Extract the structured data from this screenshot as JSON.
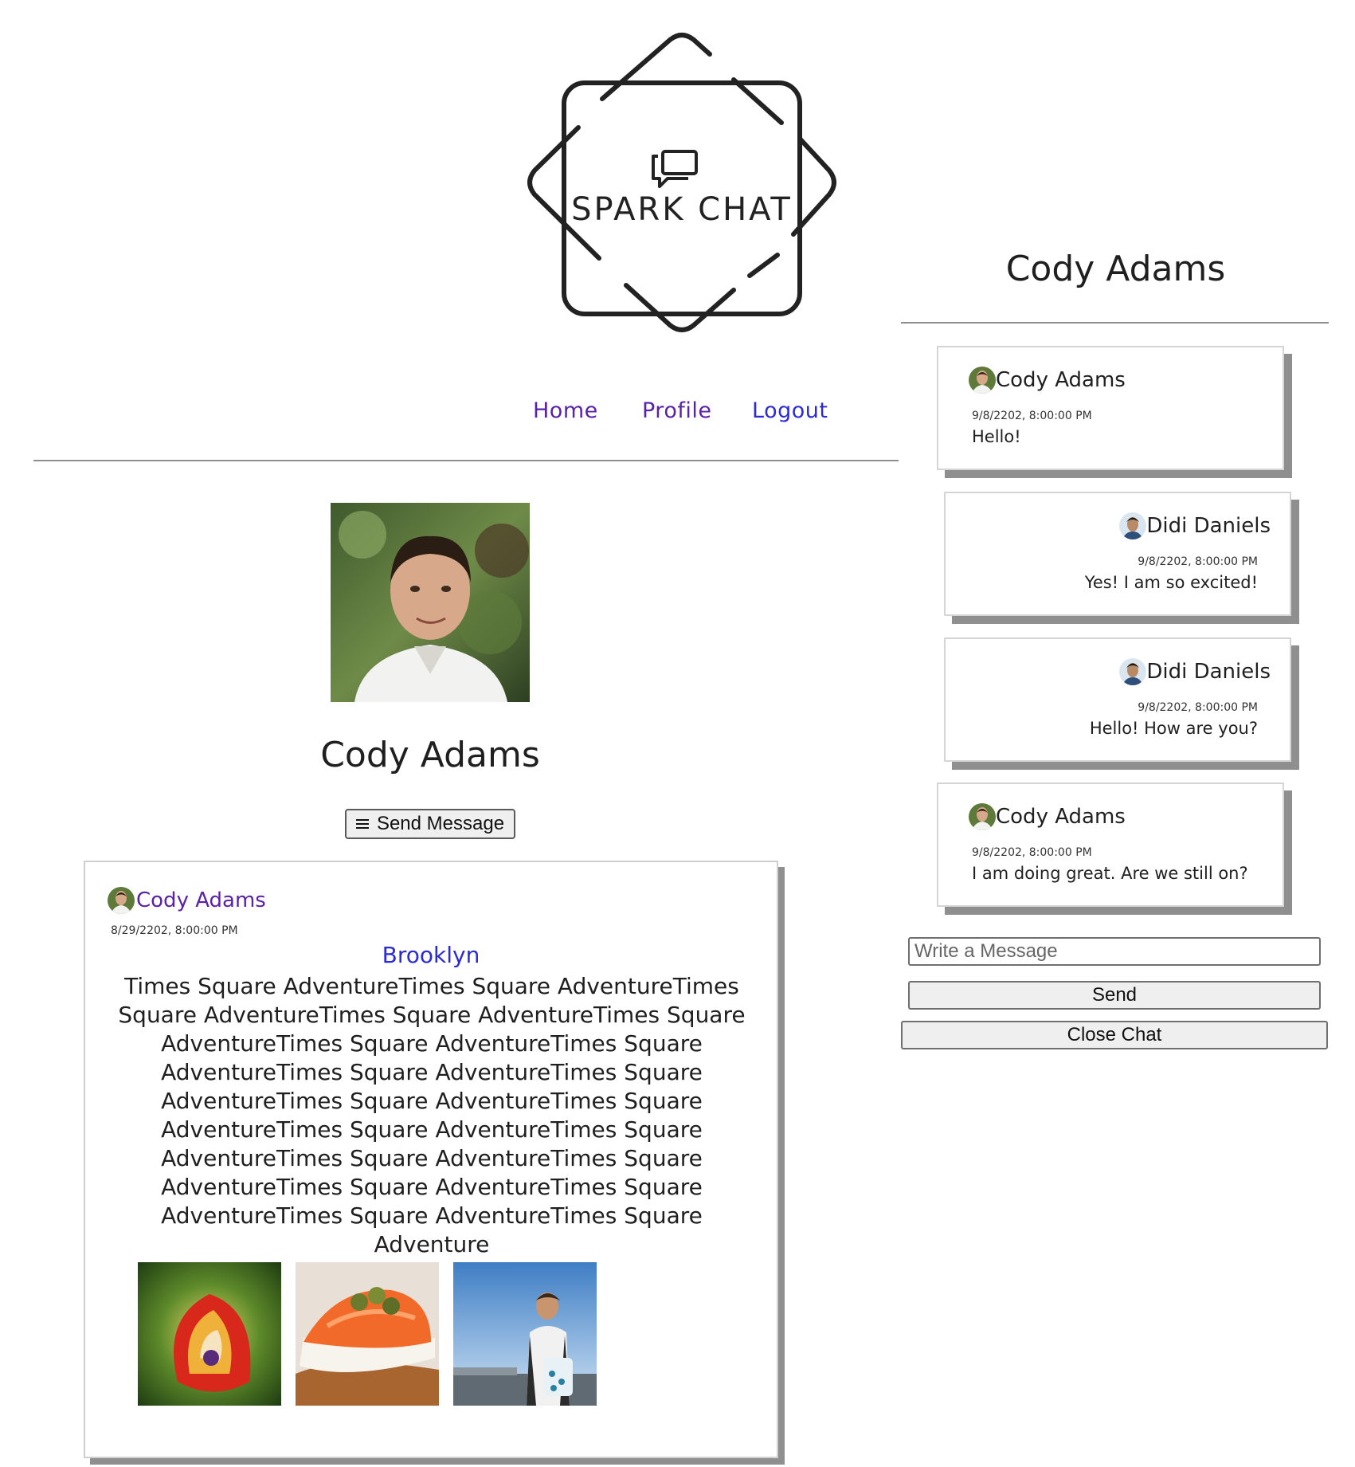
{
  "logo": {
    "text": "SPARK CHAT"
  },
  "nav": {
    "home": "Home",
    "profile": "Profile",
    "logout": "Logout"
  },
  "profile": {
    "name": "Cody Adams",
    "send_message_label": "Send Message"
  },
  "post": {
    "author": "Cody Adams",
    "date": "8/29/2202, 8:00:00 PM",
    "location": "Brooklyn",
    "lines": [
      "Times Square AdventureTimes Square AdventureTimes",
      "Square AdventureTimes Square AdventureTimes Square",
      "AdventureTimes Square AdventureTimes Square",
      "AdventureTimes Square AdventureTimes Square",
      "AdventureTimes Square AdventureTimes Square",
      "AdventureTimes Square AdventureTimes Square",
      "AdventureTimes Square AdventureTimes Square",
      "AdventureTimes Square AdventureTimes Square",
      "AdventureTimes Square AdventureTimes Square Adventure"
    ],
    "images": [
      "flower-photo",
      "salmon-toast-photo",
      "person-at-harbor-photo"
    ]
  },
  "chat": {
    "title": "Cody Adams",
    "messages": [
      {
        "author": "Cody Adams",
        "date": "9/8/2202, 8:00:00 PM",
        "text": "Hello!",
        "side": "left"
      },
      {
        "author": "Didi Daniels",
        "date": "9/8/2202, 8:00:00 PM",
        "text": "Yes! I am so excited!",
        "side": "right"
      },
      {
        "author": "Didi Daniels",
        "date": "9/8/2202, 8:00:00 PM",
        "text": "Hello! How are you?",
        "side": "right"
      },
      {
        "author": "Cody Adams",
        "date": "9/8/2202, 8:00:00 PM",
        "text": "I am doing great. Are we still on?",
        "side": "left"
      }
    ],
    "input_placeholder": "Write a Message",
    "send_label": "Send",
    "close_label": "Close Chat"
  },
  "colors": {
    "nav_link": "#5a22a8",
    "nav_link_visited": "#2b2bd6",
    "card_shadow": "#8f8f8f"
  }
}
